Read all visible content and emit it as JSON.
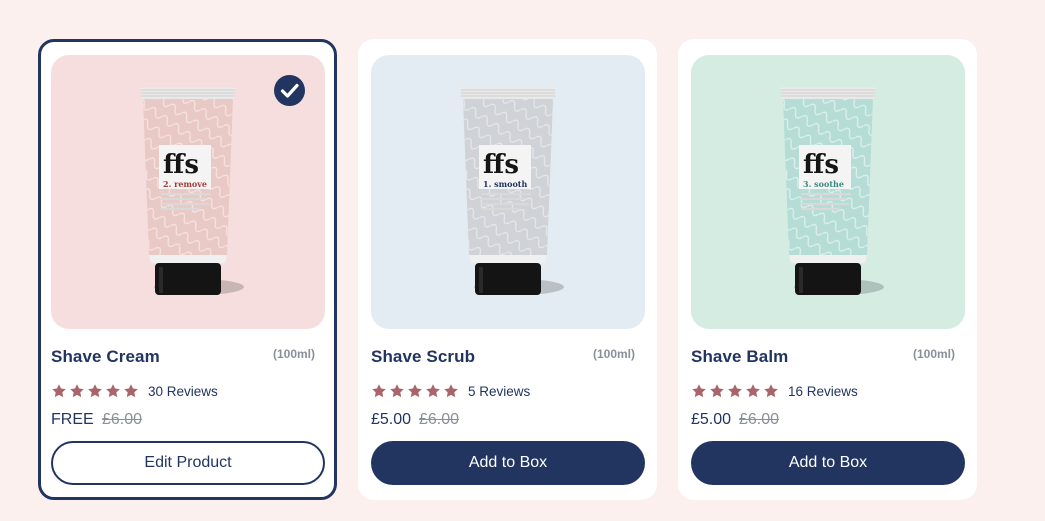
{
  "products": [
    {
      "name": "Shave Cream",
      "size": "(100ml)",
      "rating": 5,
      "reviews": "30 Reviews",
      "price": "FREE",
      "old_price": "£6.00",
      "button": "Edit Product",
      "selected": true,
      "bg": "#f5dedd",
      "tube_color": "#e9c9c6",
      "pattern_color": "#f6e4e1",
      "label_step": "2. remove",
      "step_color": "#a83a3a",
      "brand": "ffs"
    },
    {
      "name": "Shave Scrub",
      "size": "(100ml)",
      "rating": 5,
      "reviews": "5 Reviews",
      "price": "£5.00",
      "old_price": "£6.00",
      "button": "Add to Box",
      "selected": false,
      "bg": "#e2ecf2",
      "tube_color": "#cfd2d6",
      "pattern_color": "#e6e8ea",
      "label_step": "1. smooth",
      "step_color": "#223560",
      "brand": "ffs"
    },
    {
      "name": "Shave Balm",
      "size": "(100ml)",
      "rating": 5,
      "reviews": "16 Reviews",
      "price": "£5.00",
      "old_price": "£6.00",
      "button": "Add to Box",
      "selected": false,
      "bg": "#d5ece3",
      "tube_color": "#b5ddd6",
      "pattern_color": "#dff1ec",
      "label_step": "3. soothe",
      "step_color": "#3a8a80",
      "brand": "ffs"
    }
  ],
  "colors": {
    "accent": "#223560",
    "star": "#a8666b",
    "page_bg": "#fcf0ef"
  }
}
